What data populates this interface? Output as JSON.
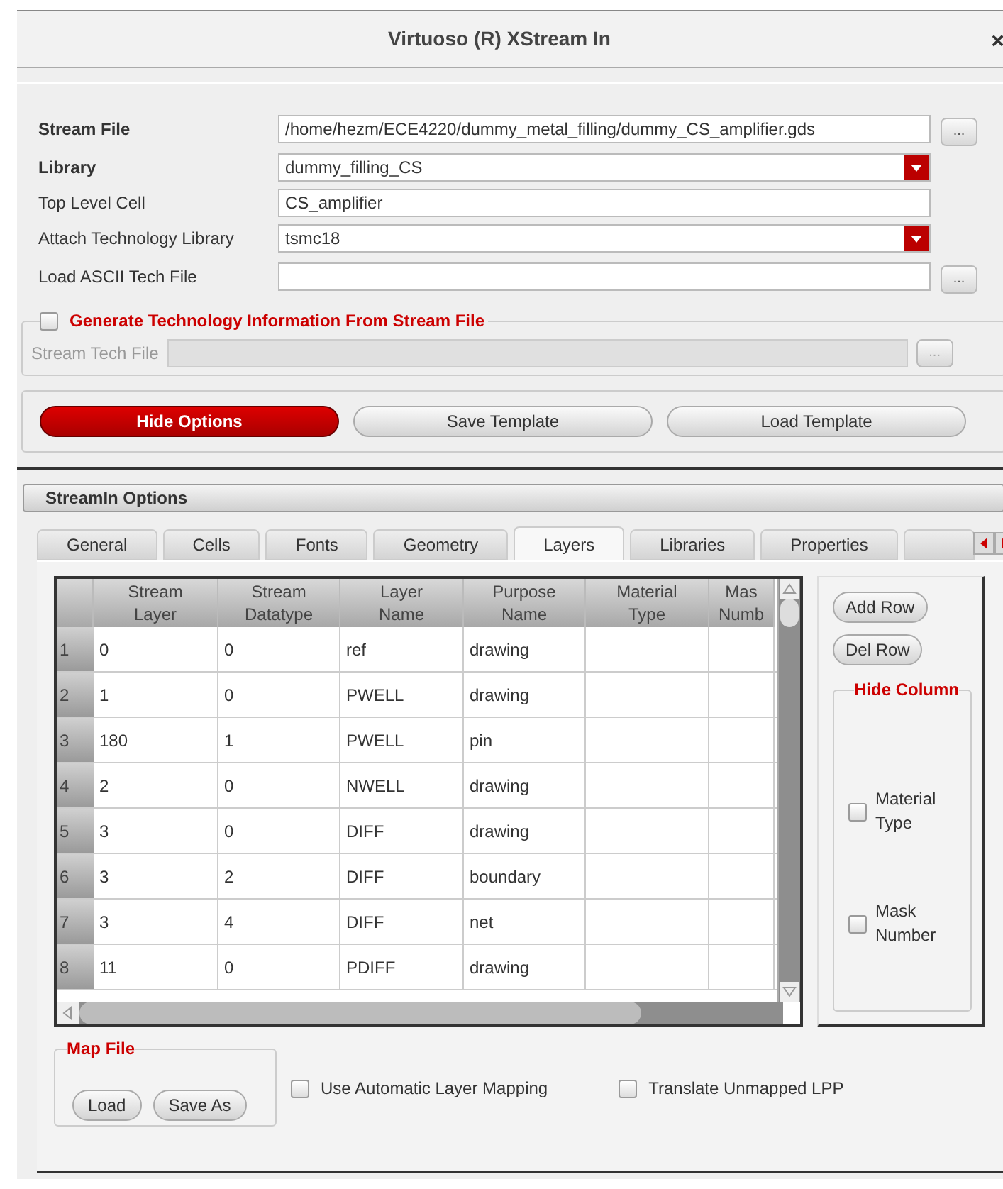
{
  "window": {
    "title": "Virtuoso (R) XStream In",
    "close": "×"
  },
  "fields": [
    {
      "label": "Stream File",
      "bold": true,
      "kind": "text",
      "value": "/home/hezm/ECE4220/dummy_metal_filling/dummy_CS_amplifier.gds",
      "browse": "..."
    },
    {
      "label": "Library",
      "bold": true,
      "kind": "dropdown",
      "value": "dummy_filling_CS"
    },
    {
      "label": "Top Level Cell",
      "bold": false,
      "kind": "text",
      "value": "CS_amplifier"
    },
    {
      "label": "Attach Technology Library",
      "bold": false,
      "kind": "dropdown",
      "value": "tsmc18"
    },
    {
      "label": "Load ASCII Tech File",
      "bold": false,
      "kind": "text",
      "browse": "..."
    }
  ],
  "generate": {
    "label": "Generate Technology Information From Stream File",
    "checked": false,
    "field_label": "Stream Tech File",
    "disabled": true,
    "browse": "..."
  },
  "actions": [
    {
      "label": "Hide Options",
      "primary": true
    },
    {
      "label": "Save Template",
      "primary": false
    },
    {
      "label": "Load Template",
      "primary": false
    }
  ],
  "options_title": "StreamIn Options",
  "tabs": [
    {
      "label": "General",
      "selected": false
    },
    {
      "label": "Cells",
      "selected": false
    },
    {
      "label": "Fonts",
      "selected": false
    },
    {
      "label": "Geometry",
      "selected": false
    },
    {
      "label": "Layers",
      "selected": true
    },
    {
      "label": "Libraries",
      "selected": false
    },
    {
      "label": "Properties",
      "selected": false
    }
  ],
  "table": {
    "columns": [
      "Stream\nLayer",
      "Stream\nDatatype",
      "Layer\nName",
      "Purpose\nName",
      "Material\nType",
      "Mas\nNumb"
    ],
    "rows": [
      {
        "index": "1",
        "cells": [
          "0",
          "0",
          "ref",
          "drawing"
        ]
      },
      {
        "index": "2",
        "cells": [
          "1",
          "0",
          "PWELL",
          "drawing"
        ]
      },
      {
        "index": "3",
        "cells": [
          "180",
          "1",
          "PWELL",
          "pin"
        ]
      },
      {
        "index": "4",
        "cells": [
          "2",
          "0",
          "NWELL",
          "drawing"
        ]
      },
      {
        "index": "5",
        "cells": [
          "3",
          "0",
          "DIFF",
          "drawing"
        ]
      },
      {
        "index": "6",
        "cells": [
          "3",
          "2",
          "DIFF",
          "boundary"
        ]
      },
      {
        "index": "7",
        "cells": [
          "3",
          "4",
          "DIFF",
          "net"
        ]
      },
      {
        "index": "8",
        "cells": [
          "11",
          "0",
          "PDIFF",
          "drawing"
        ]
      }
    ]
  },
  "row_buttons": [
    "Add Row",
    "Del Row"
  ],
  "hide_column": {
    "title": "Hide Column",
    "options": [
      {
        "label": "Material\nType",
        "checked": false
      },
      {
        "label": "Mask\nNumber",
        "checked": false
      }
    ]
  },
  "map_file": {
    "title": "Map File",
    "buttons": [
      "Load",
      "Save As"
    ]
  },
  "bottom_options": [
    {
      "label": "Use Automatic Layer Mapping",
      "checked": false
    },
    {
      "label": "Translate Unmapped LPP",
      "checked": false
    }
  ]
}
